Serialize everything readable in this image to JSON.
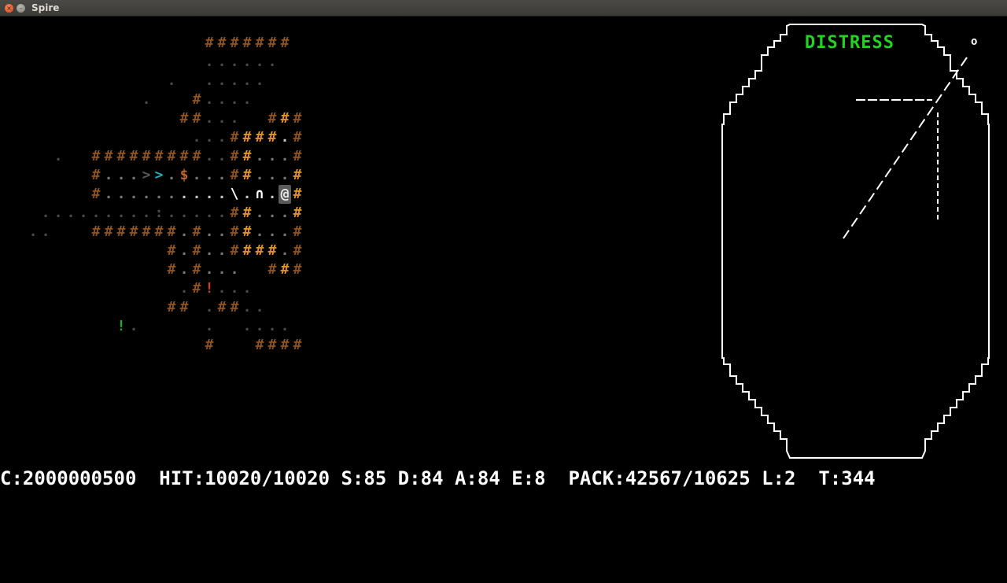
{
  "window": {
    "title": "Spire"
  },
  "radar": {
    "label": "DISTRESS",
    "corner_mark": "o"
  },
  "status": {
    "text": "C:2000000500  HIT:10020/10020 S:85 D:84 A:84 E:8  PACK:42567/10625 L:2  T:344"
  },
  "map_rows": [
    {
      "r": 0,
      "cells": [
        [
          16,
          "#",
          "wall"
        ],
        [
          17,
          "#",
          "wall"
        ],
        [
          18,
          "#",
          "wall"
        ],
        [
          19,
          "#",
          "wall"
        ],
        [
          20,
          "#",
          "wall"
        ],
        [
          21,
          "#",
          "wall"
        ],
        [
          22,
          "#",
          "wall"
        ]
      ]
    },
    {
      "r": 1,
      "cells": [
        [
          16,
          ".",
          "floorD"
        ],
        [
          17,
          ".",
          "floorD"
        ],
        [
          18,
          ".",
          "floorD"
        ],
        [
          19,
          ".",
          "floorD"
        ],
        [
          20,
          ".",
          "floorD"
        ],
        [
          21,
          ".",
          "floorD"
        ]
      ]
    },
    {
      "r": 2,
      "cells": [
        [
          13,
          ".",
          "floorD"
        ],
        [
          16,
          ".",
          "floorD"
        ],
        [
          17,
          ".",
          "floorD"
        ],
        [
          18,
          ".",
          "floorD"
        ],
        [
          19,
          ".",
          "floorD"
        ],
        [
          20,
          ".",
          "floorD"
        ]
      ]
    },
    {
      "r": 3,
      "cells": [
        [
          11,
          ".",
          "floorD"
        ],
        [
          15,
          "#",
          "wall"
        ],
        [
          16,
          ".",
          "floorD"
        ],
        [
          17,
          ".",
          "floorD"
        ],
        [
          18,
          ".",
          "floorD"
        ],
        [
          19,
          ".",
          "floorD"
        ]
      ]
    },
    {
      "r": 4,
      "cells": [
        [
          14,
          "#",
          "wall"
        ],
        [
          15,
          "#",
          "wall"
        ],
        [
          16,
          ".",
          "floorD"
        ],
        [
          17,
          ".",
          "floorD"
        ],
        [
          18,
          ".",
          "floorD"
        ],
        [
          21,
          "#",
          "wall"
        ],
        [
          22,
          "#",
          "wall2"
        ],
        [
          23,
          "#",
          "wall"
        ]
      ]
    },
    {
      "r": 5,
      "cells": [
        [
          15,
          ".",
          "floorD"
        ],
        [
          16,
          ".",
          "floorD"
        ],
        [
          17,
          ".",
          "floorD"
        ],
        [
          18,
          "#",
          "wall"
        ],
        [
          19,
          "#",
          "wall2"
        ],
        [
          20,
          "#",
          "wall2"
        ],
        [
          21,
          "#",
          "wall2"
        ],
        [
          22,
          ".",
          "floorL"
        ],
        [
          23,
          "#",
          "wall"
        ]
      ]
    },
    {
      "r": 6,
      "cells": [
        [
          4,
          ".",
          "floorD"
        ],
        [
          7,
          "#",
          "wall"
        ],
        [
          8,
          "#",
          "wall"
        ],
        [
          9,
          "#",
          "wall"
        ],
        [
          10,
          "#",
          "wall"
        ],
        [
          11,
          "#",
          "wall"
        ],
        [
          12,
          "#",
          "wall"
        ],
        [
          13,
          "#",
          "wall"
        ],
        [
          14,
          "#",
          "wall"
        ],
        [
          15,
          "#",
          "wall"
        ],
        [
          16,
          ".",
          "floorD"
        ],
        [
          17,
          ".",
          "floorD"
        ],
        [
          18,
          "#",
          "wall"
        ],
        [
          19,
          "#",
          "wall2"
        ],
        [
          20,
          ".",
          "floor"
        ],
        [
          21,
          ".",
          "floor"
        ],
        [
          22,
          ".",
          "floor"
        ],
        [
          23,
          "#",
          "wall"
        ]
      ]
    },
    {
      "r": 7,
      "cells": [
        [
          7,
          "#",
          "wall"
        ],
        [
          8,
          ".",
          "floor"
        ],
        [
          9,
          ".",
          "floor"
        ],
        [
          10,
          ".",
          "floor"
        ],
        [
          11,
          ">",
          "stairs2"
        ],
        [
          12,
          ">",
          "stairs"
        ],
        [
          13,
          ".",
          "floor"
        ],
        [
          14,
          "$",
          "gold"
        ],
        [
          15,
          ".",
          "floor"
        ],
        [
          16,
          ".",
          "floor"
        ],
        [
          17,
          ".",
          "floor"
        ],
        [
          18,
          "#",
          "wall"
        ],
        [
          19,
          "#",
          "wall2"
        ],
        [
          20,
          ".",
          "floor"
        ],
        [
          21,
          ".",
          "floor"
        ],
        [
          22,
          ".",
          "floor"
        ],
        [
          23,
          "#",
          "wall2"
        ]
      ]
    },
    {
      "r": 8,
      "cells": [
        [
          7,
          "#",
          "wall"
        ],
        [
          8,
          ".",
          "floor"
        ],
        [
          9,
          ".",
          "floor"
        ],
        [
          10,
          ".",
          "floor"
        ],
        [
          11,
          ".",
          "floor"
        ],
        [
          12,
          ".",
          "floor"
        ],
        [
          13,
          ".",
          "floor"
        ],
        [
          14,
          ".",
          "floorL"
        ],
        [
          15,
          ".",
          "floorL"
        ],
        [
          16,
          ".",
          "floorL"
        ],
        [
          17,
          ".",
          "floorL"
        ],
        [
          18,
          "\\",
          "white"
        ],
        [
          19,
          ".",
          "floorL"
        ],
        [
          20,
          "∩",
          "white"
        ],
        [
          21,
          ".",
          "floorL"
        ],
        [
          22,
          "@",
          "player"
        ],
        [
          23,
          "#",
          "wall2"
        ]
      ]
    },
    {
      "r": 9,
      "cells": [
        [
          3,
          ".",
          "floorD"
        ],
        [
          4,
          ".",
          "floorD"
        ],
        [
          5,
          ".",
          "floorD"
        ],
        [
          6,
          ".",
          "floorD"
        ],
        [
          7,
          ".",
          "floorD"
        ],
        [
          8,
          ".",
          "floorD"
        ],
        [
          9,
          ".",
          "floorD"
        ],
        [
          10,
          ".",
          "floorD"
        ],
        [
          11,
          ".",
          "floorD"
        ],
        [
          12,
          ":",
          "floorD"
        ],
        [
          13,
          ".",
          "floorD"
        ],
        [
          14,
          ".",
          "floorD"
        ],
        [
          15,
          ".",
          "floorD"
        ],
        [
          16,
          ".",
          "floorD"
        ],
        [
          17,
          ".",
          "floorD"
        ],
        [
          18,
          "#",
          "wall"
        ],
        [
          19,
          "#",
          "wall2"
        ],
        [
          20,
          ".",
          "floor"
        ],
        [
          21,
          ".",
          "floor"
        ],
        [
          22,
          ".",
          "floor"
        ],
        [
          23,
          "#",
          "wall2"
        ]
      ]
    },
    {
      "r": 10,
      "cells": [
        [
          2,
          ".",
          "floorD"
        ],
        [
          3,
          ".",
          "floorD"
        ],
        [
          7,
          "#",
          "wall"
        ],
        [
          8,
          "#",
          "wall"
        ],
        [
          9,
          "#",
          "wall"
        ],
        [
          10,
          "#",
          "wall"
        ],
        [
          11,
          "#",
          "wall"
        ],
        [
          12,
          "#",
          "wall"
        ],
        [
          13,
          "#",
          "wall"
        ],
        [
          14,
          ".",
          "floor"
        ],
        [
          15,
          "#",
          "wall"
        ],
        [
          16,
          ".",
          "floor"
        ],
        [
          17,
          ".",
          "floor"
        ],
        [
          18,
          "#",
          "wall"
        ],
        [
          19,
          "#",
          "wall2"
        ],
        [
          20,
          ".",
          "floor"
        ],
        [
          21,
          ".",
          "floor"
        ],
        [
          22,
          ".",
          "floor"
        ],
        [
          23,
          "#",
          "wall"
        ]
      ]
    },
    {
      "r": 11,
      "cells": [
        [
          13,
          "#",
          "wall"
        ],
        [
          14,
          ".",
          "floor"
        ],
        [
          15,
          "#",
          "wall"
        ],
        [
          16,
          ".",
          "floor"
        ],
        [
          17,
          ".",
          "floor"
        ],
        [
          18,
          "#",
          "wall"
        ],
        [
          19,
          "#",
          "wall2"
        ],
        [
          20,
          "#",
          "wall2"
        ],
        [
          21,
          "#",
          "wall2"
        ],
        [
          22,
          ".",
          "floor"
        ],
        [
          23,
          "#",
          "wall"
        ]
      ]
    },
    {
      "r": 12,
      "cells": [
        [
          13,
          "#",
          "wall"
        ],
        [
          14,
          ".",
          "floor"
        ],
        [
          15,
          "#",
          "wall"
        ],
        [
          16,
          ".",
          "floor"
        ],
        [
          17,
          ".",
          "floor"
        ],
        [
          18,
          ".",
          "floor"
        ],
        [
          21,
          "#",
          "wall"
        ],
        [
          22,
          "#",
          "wall2"
        ],
        [
          23,
          "#",
          "wall"
        ]
      ]
    },
    {
      "r": 13,
      "cells": [
        [
          14,
          ".",
          "floorD"
        ],
        [
          15,
          "#",
          "wall"
        ],
        [
          16,
          "!",
          "potion"
        ],
        [
          17,
          ".",
          "floorD"
        ],
        [
          18,
          ".",
          "floorD"
        ],
        [
          19,
          ".",
          "floorD"
        ]
      ]
    },
    {
      "r": 14,
      "cells": [
        [
          13,
          "#",
          "wall"
        ],
        [
          14,
          "#",
          "wall"
        ],
        [
          16,
          ".",
          "floorD"
        ],
        [
          17,
          "#",
          "wall"
        ],
        [
          18,
          "#",
          "wall"
        ],
        [
          19,
          ".",
          "floorD"
        ],
        [
          20,
          ".",
          "floorD"
        ]
      ]
    },
    {
      "r": 15,
      "cells": [
        [
          9,
          "!",
          "potionG"
        ],
        [
          10,
          ".",
          "floorD"
        ],
        [
          16,
          ".",
          "floorD"
        ],
        [
          19,
          ".",
          "floorD"
        ],
        [
          20,
          ".",
          "floorD"
        ],
        [
          21,
          ".",
          "floorD"
        ],
        [
          22,
          ".",
          "floorD"
        ]
      ]
    },
    {
      "r": 16,
      "cells": [
        [
          16,
          "#",
          "wall"
        ],
        [
          20,
          "#",
          "wall"
        ],
        [
          21,
          "#",
          "wall"
        ],
        [
          22,
          "#",
          "wall"
        ],
        [
          23,
          "#",
          "wall"
        ]
      ]
    }
  ]
}
